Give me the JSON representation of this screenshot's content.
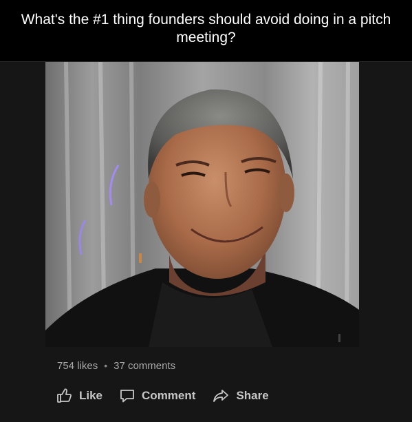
{
  "question": {
    "text": "What's the #1 thing founders should avoid doing in a pitch meeting?"
  },
  "video": {
    "content": "video-still"
  },
  "stats": {
    "likes": "754 likes",
    "separator": "•",
    "comments": "37 comments"
  },
  "actions": {
    "like_label": "Like",
    "like_icon": "thumbs-up-icon",
    "comment_label": "Comment",
    "comment_icon": "speech-bubble-icon",
    "share_label": "Share",
    "share_icon": "share-arrow-icon"
  },
  "colors": {
    "background": "#161616",
    "header": "#000000",
    "stat_text": "#a9a9a9",
    "action_text": "#c7c7c7"
  }
}
